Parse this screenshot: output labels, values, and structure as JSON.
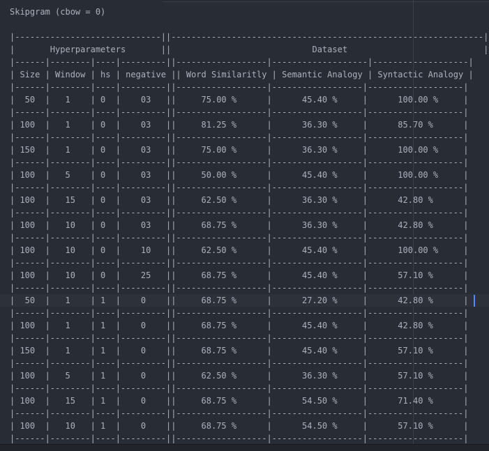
{
  "editor": {
    "title": "Skipgram (cbow = 0)",
    "blank": "",
    "sep_top": "|-----------------------------||--------------------------------------------------------------|",
    "header_group": "|       Hyperparameters       ||                            Dataset                           |",
    "sep_cols": "|------|--------|----|---------||------------------|-------------------|-------------------|",
    "header_cols": "| Size | Window | hs | negative || Word Similaritly | Semantic Analogy | Syntactic Analogy |",
    "sep_row": "|------|--------|----|---------||------------------|------------------|-------------------|",
    "rows": [
      "|  50  |   1    | 0  |    03   ||     75.00 %      |      45.40 %     |      100.00 %     |",
      "| 100  |   1    | 0  |    03   ||     81.25 %      |      36.30 %     |      85.70 %      |",
      "| 150  |   1    | 0  |    03   ||     75.00 %      |      36.30 %     |      100.00 %     |",
      "| 100  |   5    | 0  |    03   ||     50.00 %      |      45.40 %     |      100.00 %     |",
      "| 100  |   15   | 0  |    03   ||     62.50 %      |      36.30 %     |      42.80 %      |",
      "| 100  |   10   | 0  |    03   ||     68.75 %      |      36.30 %     |      42.80 %      |",
      "| 100  |   10   | 0  |    10   ||     62.50 %      |      45.40 %     |      100.00 %     |",
      "| 100  |   10   | 0  |    25   ||     68.75 %      |      45.40 %     |      57.10 %      |",
      "|  50  |   1    | 1  |    0    ||     68.75 %      |      27.20 %     |      42.80 %      |",
      "| 100  |   1    | 1  |    0    ||     68.75 %      |      45.40 %     |      42.80 %      |",
      "| 150  |   1    | 1  |    0    ||     68.75 %      |      45.40 %     |      57.10 %      |",
      "| 100  |   5    | 1  |    0    ||     62.50 %      |      36.30 %     |      57.10 %      |",
      "| 100  |   15   | 1  |    0    ||     68.75 %      |      54.50 %     |      71.40 %      |",
      "| 100  |   10   | 1  |    0    ||     68.75 %      |      54.50 %     |      57.10 %      |"
    ]
  },
  "colors": {
    "background": "#282c34",
    "text": "#abb2bf",
    "active_line": "#2c313a",
    "cursor": "#528bff",
    "ruler": "#3b4048"
  }
}
